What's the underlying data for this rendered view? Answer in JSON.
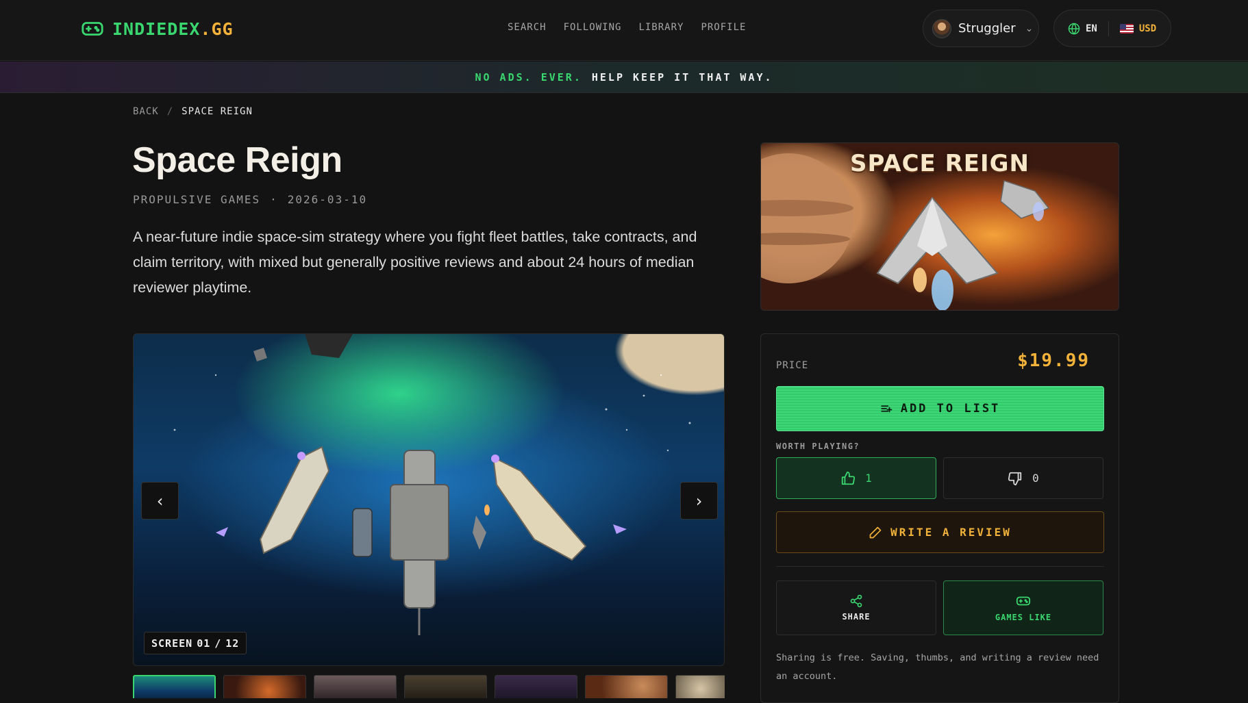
{
  "brand": {
    "name_main": "INDIEDEX",
    "name_dot": ".GG",
    "icon": "gamepad-icon"
  },
  "nav": {
    "items": [
      "SEARCH",
      "FOLLOWING",
      "LIBRARY",
      "PROFILE"
    ]
  },
  "user": {
    "name": "Struggler"
  },
  "locale": {
    "language": "EN",
    "currency": "USD"
  },
  "banner": {
    "highlight": "NO ADS. EVER.",
    "rest": "HELP KEEP IT THAT WAY."
  },
  "breadcrumb": {
    "back": "BACK",
    "separator": "/",
    "current": "SPACE REIGN"
  },
  "game": {
    "title": "Space Reign",
    "developer": "PROPULSIVE GAMES",
    "meta_separator": "·",
    "release_date": "2026-03-10",
    "description": "A near-future indie space-sim strategy where you fight fleet battles, take contracts, and claim territory, with mixed but generally positive reviews and about 24 hours of median reviewer playtime.",
    "cover_title": "SPACE REIGN"
  },
  "gallery": {
    "screen_label": "SCREEN",
    "current": "01",
    "separator": "/",
    "total": "12",
    "thumb_count": 7
  },
  "purchase": {
    "price_label": "PRICE",
    "price": "$19.99",
    "add_to_list": "ADD TO LIST",
    "worth_playing": "WORTH PLAYING?",
    "thumbs_up": "1",
    "thumbs_down": "0",
    "write_review": "WRITE A REVIEW",
    "share": "SHARE",
    "games_like": "GAMES LIKE",
    "note": "Sharing is free. Saving, thumbs, and writing a review need an account."
  },
  "colors": {
    "accent_green": "#3ad66f",
    "accent_amber": "#f2b23a",
    "background": "#131313"
  }
}
